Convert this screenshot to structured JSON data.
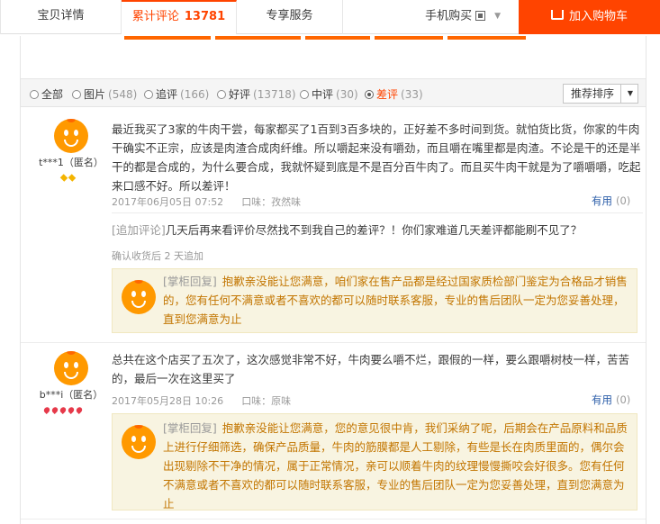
{
  "tabs": {
    "detail": "宝贝详情",
    "reviews": "累计评论",
    "reviews_count": "13781",
    "service": "专享服务",
    "mobile": "手机购买",
    "add_to_cart": "加入购物车"
  },
  "filters": [
    {
      "label": "全部",
      "count": "",
      "selected": false
    },
    {
      "label": "图片",
      "count": "(548)",
      "selected": false
    },
    {
      "label": "追评",
      "count": "(166)",
      "selected": false
    },
    {
      "label": "好评",
      "count": "(13718)",
      "selected": false
    },
    {
      "label": "中评",
      "count": "(30)",
      "selected": false
    },
    {
      "label": "差评",
      "count": "(33)",
      "selected": true
    }
  ],
  "sort_label": "推荐排序",
  "reviews": [
    {
      "user": "t***1（匿名）",
      "badge_type": "gold",
      "content": "最近我买了3家的牛肉干尝，每家都买了1百到3百多块的，正好差不多时间到货。就怕货比货，你家的牛肉干确实不正宗，应该是肉渣合成肉纤维。所以嚼起来没有嚼劲，而且嚼在嘴里都是肉渣。不论是干的还是半干的都是合成的，为什么要合成，我就怀疑到底是不是百分百牛肉了。而且买牛肉干就是为了嚼嚼嚼，吃起来口感不好。所以差评！",
      "date": "2017年06月05日 07:52",
      "taste": "口味：孜然味",
      "helpful_label": "有用",
      "helpful_count": "(0)",
      "followup_tag": "[追加评论]",
      "followup_text": "几天后再来看评价尽然找不到我自己的差评？！你们家难道几天差评都能刷不见了？",
      "followup_meta": "确认收货后 2 天追加",
      "reply_tag": "[掌柜回复]",
      "reply_text": "抱歉亲没能让您满意，咱们家在售产品都是经过国家质检部门鉴定为合格品才销售的，您有任何不满意或者不喜欢的都可以随时联系客服，专业的售后团队一定为您妥善处理，直到您满意为止"
    },
    {
      "user": "b***i（匿名）",
      "badge_type": "red",
      "content": "总共在这个店买了五次了，这次感觉非常不好，牛肉要么嚼不烂，跟假的一样，要么跟嚼树枝一样，苦苦的，最后一次在这里买了",
      "date": "2017年05月28日 10:26",
      "taste": "口味：原味",
      "helpful_label": "有用",
      "helpful_count": "(0)",
      "reply_tag": "[掌柜回复]",
      "reply_text": "抱歉亲没能让您满意，您的意见很中肯，我们采纳了呢，后期会在产品原料和品质上进行仔细筛选，确保产品质量，牛肉的筋膜都是人工剔除，有些是长在肉质里面的，偶尔会出现剔除不干净的情况，属于正常情况，亲可以顺着牛肉的纹理慢慢撕咬会好很多。您有任何不满意或者不喜欢的都可以随时联系客服，专业的售后团队一定为您妥善处理，直到您满意为止"
    }
  ]
}
